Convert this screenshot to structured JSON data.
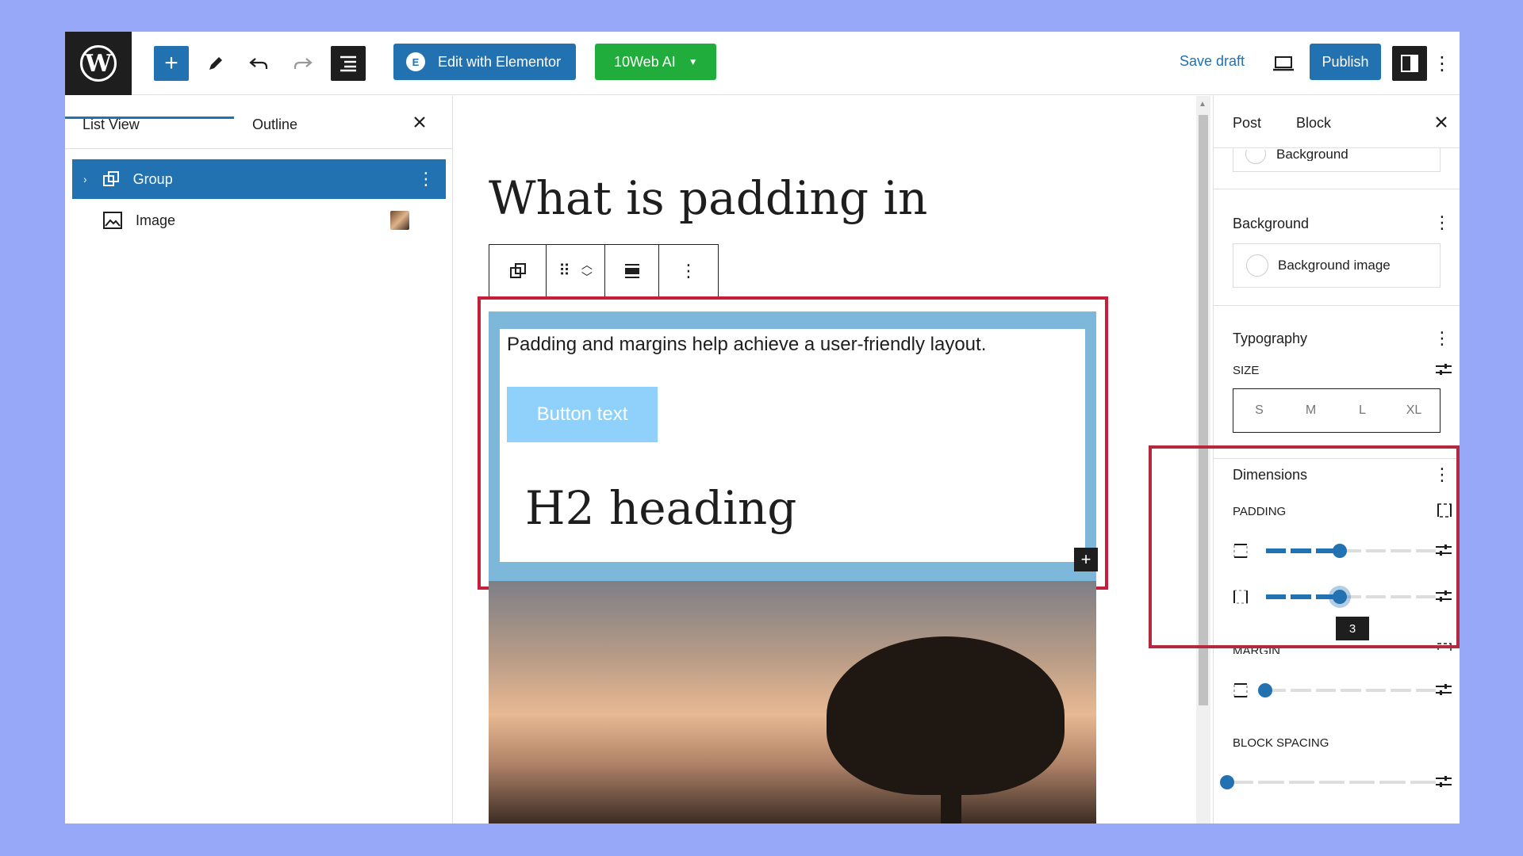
{
  "topbar": {
    "elementor_label": "Edit with Elementor",
    "elementor_badge": "E",
    "ai_label": "10Web AI",
    "save_draft": "Save draft",
    "publish": "Publish"
  },
  "left_panel": {
    "tabs": [
      {
        "label": "List View"
      },
      {
        "label": "Outline"
      }
    ],
    "items": [
      {
        "label": "Group"
      },
      {
        "label": "Image"
      }
    ]
  },
  "canvas": {
    "post_title": "What is padding in",
    "paragraph": "Padding and margins help achieve a user-friendly layout.",
    "button_text": "Button text",
    "h2": "H2 heading"
  },
  "right_panel": {
    "tabs": [
      {
        "label": "Post"
      },
      {
        "label": "Block"
      }
    ],
    "stub_label": "Background",
    "background": {
      "title": "Background",
      "image_label": "Background image"
    },
    "typography": {
      "title": "Typography",
      "size_label": "SIZE",
      "sizes": [
        "S",
        "M",
        "L",
        "XL"
      ]
    },
    "dimensions": {
      "title": "Dimensions",
      "padding_label": "PADDING",
      "margin_label": "MARGIN",
      "block_spacing_label": "BLOCK SPACING",
      "tooltip": "3",
      "padding_value_1": 3,
      "padding_value_2": 3,
      "margin_value": 0,
      "block_spacing_value": 0,
      "slider_steps": 7
    }
  },
  "colors": {
    "accent": "#2271b1",
    "ai_green": "#21ad3b",
    "highlight_red": "#c51f3a",
    "group_bg": "#7db7d9",
    "button_bg": "#8fd1fb",
    "page_bg": "#96a8f7"
  },
  "icons": {
    "logo": "wordpress-logo-icon",
    "add": "plus-icon",
    "edit": "pencil-icon",
    "undo": "undo-icon",
    "redo": "redo-icon",
    "doc_overview": "document-overview-icon",
    "preview": "laptop-icon",
    "settings": "sidebar-toggle-icon",
    "more": "more-vertical-icon"
  }
}
